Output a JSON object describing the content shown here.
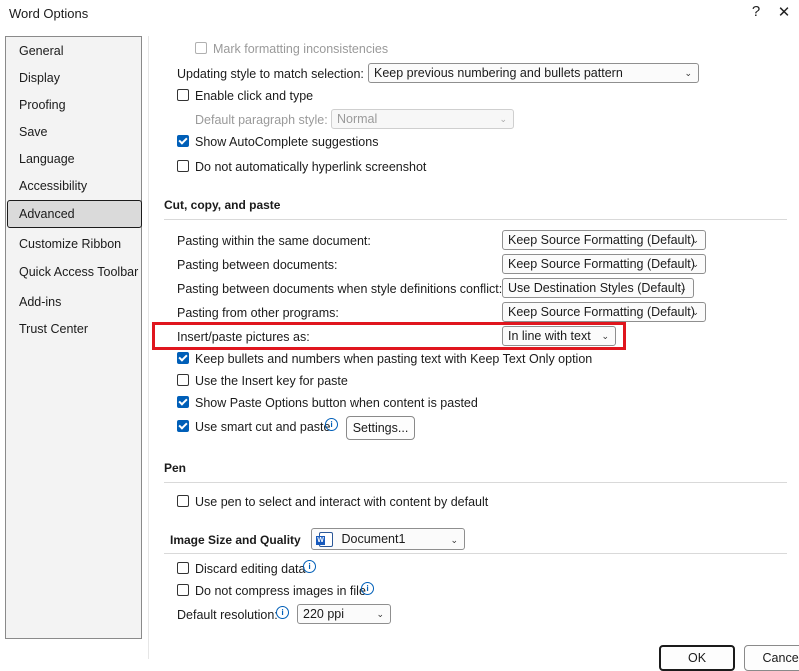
{
  "window": {
    "title": "Word Options",
    "help": "?",
    "close": "✕"
  },
  "sidebar": {
    "items": [
      {
        "label": "General"
      },
      {
        "label": "Display"
      },
      {
        "label": "Proofing"
      },
      {
        "label": "Save"
      },
      {
        "label": "Language"
      },
      {
        "label": "Accessibility"
      },
      {
        "label": "Advanced"
      },
      {
        "label": "Customize Ribbon"
      },
      {
        "label": "Quick Access Toolbar"
      },
      {
        "label": "Add-ins"
      },
      {
        "label": "Trust Center"
      }
    ],
    "active": "Advanced"
  },
  "editing": {
    "mark_formatting": {
      "label": "Mark formatting inconsistencies",
      "checked": false,
      "disabled": true
    },
    "updating_style": {
      "label": "Updating style to match selection:",
      "value": "Keep previous numbering and bullets pattern"
    },
    "click_and_type": {
      "label": "Enable click and type",
      "checked": false
    },
    "default_paragraph": {
      "label": "Default paragraph style:",
      "value": "Normal",
      "disabled": true
    },
    "autocomplete": {
      "label": "Show AutoComplete suggestions",
      "checked": true
    },
    "no_hyperlink": {
      "label": "Do not automatically hyperlink screenshot",
      "checked": false
    }
  },
  "cut_copy_paste": {
    "title": "Cut, copy, and paste",
    "rows": [
      {
        "label": "Pasting within the same document:",
        "value": "Keep Source Formatting (Default)"
      },
      {
        "label": "Pasting between documents:",
        "value": "Keep Source Formatting (Default)"
      },
      {
        "label": "Pasting between documents when style definitions conflict:",
        "value": "Use Destination Styles (Default)"
      },
      {
        "label": "Pasting from other programs:",
        "value": "Keep Source Formatting (Default)"
      },
      {
        "label": "Insert/paste pictures as:",
        "value": "In line with text"
      }
    ],
    "keep_bullets": {
      "label": "Keep bullets and numbers when pasting text with Keep Text Only option",
      "checked": true
    },
    "insert_key": {
      "label": "Use the Insert key for paste",
      "checked": false
    },
    "paste_options": {
      "label": "Show Paste Options button when content is pasted",
      "checked": true
    },
    "smart_cut": {
      "label": "Use smart cut and paste",
      "checked": true
    },
    "settings_button": "Settings..."
  },
  "pen": {
    "title": "Pen",
    "use_pen": {
      "label": "Use pen to select and interact with content by default",
      "checked": false
    }
  },
  "image": {
    "title": "Image Size and Quality",
    "document": "Document1",
    "discard_editing": {
      "label": "Discard editing data",
      "checked": false
    },
    "no_compress": {
      "label": "Do not compress images in file",
      "checked": false
    },
    "resolution_label": "Default resolution:",
    "resolution": "220 ppi"
  },
  "footer": {
    "ok": "OK",
    "cancel": "Cancel"
  },
  "colors": {
    "accent": "#005fb8",
    "highlight": "#e0161e"
  }
}
